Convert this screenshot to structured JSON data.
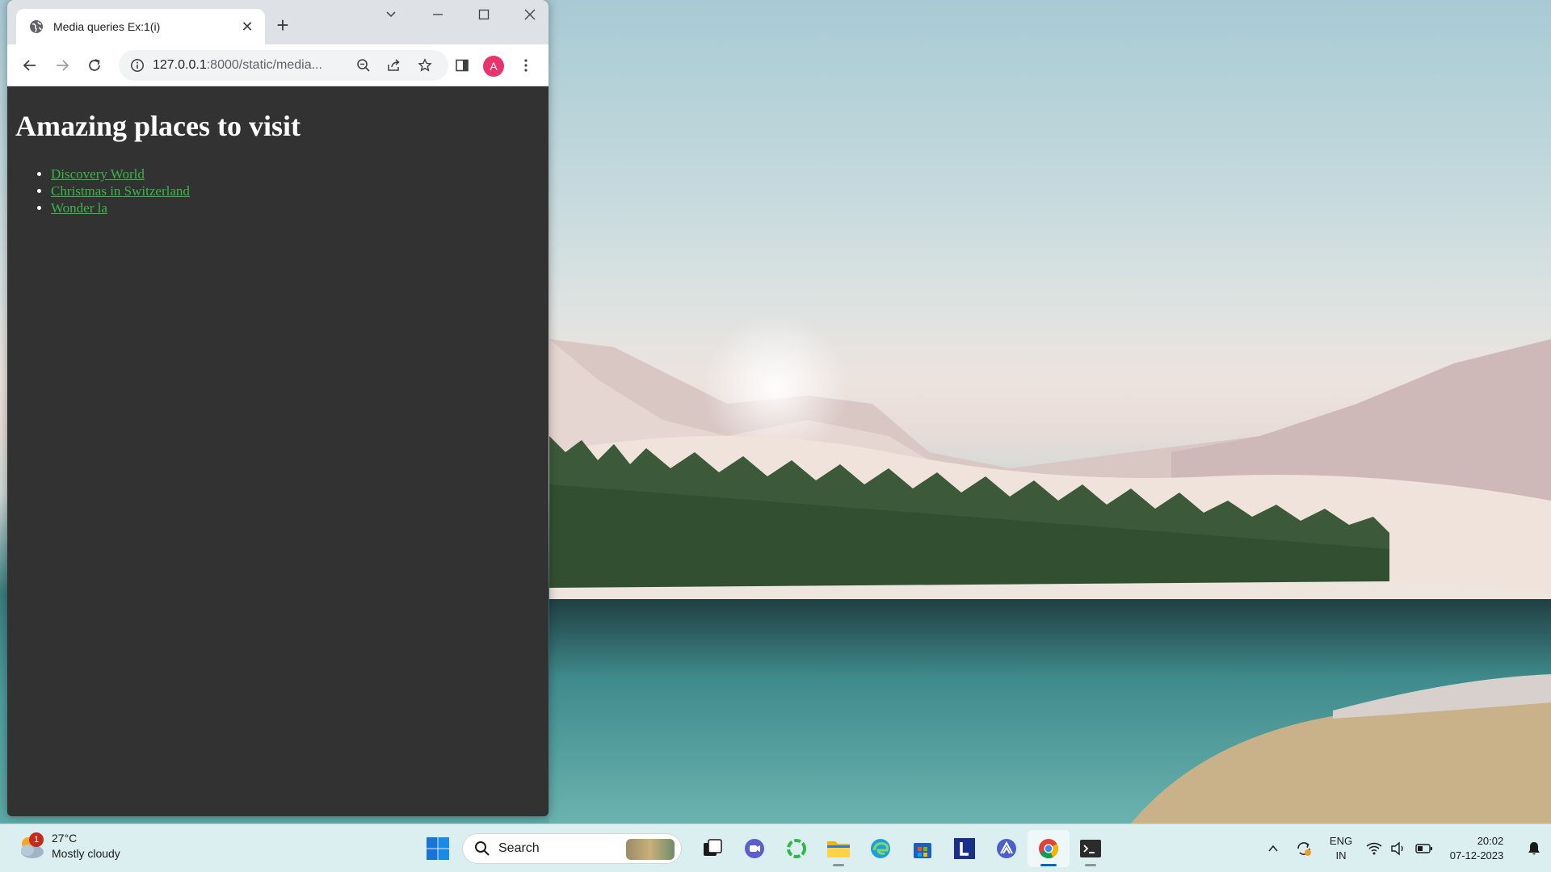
{
  "browser": {
    "tab_title": "Media queries Ex:1(i)",
    "url_host": "127.0.0.1",
    "url_path": ":8000/static/media...",
    "profile_initial": "A"
  },
  "page": {
    "heading": "Amazing places to visit",
    "links": [
      "Discovery World",
      "Christmas in Switzerland",
      "Wonder la"
    ]
  },
  "taskbar": {
    "weather": {
      "temp": "27°C",
      "condition": "Mostly cloudy",
      "badge": "1"
    },
    "search_label": "Search",
    "language": {
      "line1": "ENG",
      "line2": "IN"
    },
    "clock": {
      "time": "20:02",
      "date": "07-12-2023"
    }
  },
  "colors": {
    "page_background": "#323232",
    "link": "#3ab54a",
    "avatar": "#e8336b",
    "taskbar": "#dceff0"
  }
}
